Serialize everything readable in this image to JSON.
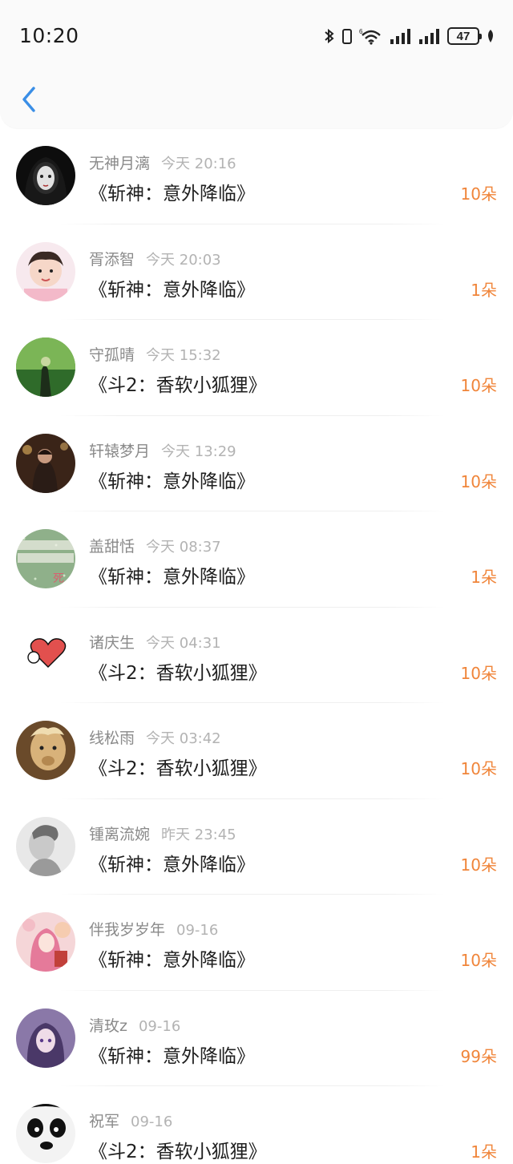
{
  "status_bar": {
    "time": "10:20",
    "battery": "47",
    "icons": [
      "bluetooth-icon",
      "vibrate-icon",
      "wifi-6-icon",
      "signal-icon",
      "signal-icon",
      "battery-icon",
      "leaf-icon"
    ]
  },
  "header": {
    "back_icon": "chevron-left-icon",
    "accent_color": "#3a8ee6"
  },
  "colors": {
    "count": "#f0853a",
    "name": "#8a8a8a",
    "time": "#b3b3b3",
    "title": "#1f1f1f"
  },
  "items": [
    {
      "name": "无神月漓",
      "time": "今天 20:16",
      "title": "《斩神：意外降临》",
      "count": "10朵",
      "avatar": "dark-gothic-girl"
    },
    {
      "name": "胥添智",
      "time": "今天 20:03",
      "title": "《斩神：意外降临》",
      "count": "1朵",
      "avatar": "baby-girl"
    },
    {
      "name": "守孤晴",
      "time": "今天 15:32",
      "title": "《斗2：香软小狐狸》",
      "count": "10朵",
      "avatar": "green-field"
    },
    {
      "name": "轩辕梦月",
      "time": "今天 13:29",
      "title": "《斩神：意外降临》",
      "count": "10朵",
      "avatar": "night-couple"
    },
    {
      "name": "盖甜恬",
      "time": "今天 08:37",
      "title": "《斩神：意外降临》",
      "count": "1朵",
      "avatar": "green-text"
    },
    {
      "name": "诸庆生",
      "time": "今天 04:31",
      "title": "《斗2：香软小狐狸》",
      "count": "10朵",
      "avatar": "heart-sticker"
    },
    {
      "name": "线松雨",
      "time": "今天 03:42",
      "title": "《斗2：香软小狐狸》",
      "count": "10朵",
      "avatar": "alpaca"
    },
    {
      "name": "锺离流婉",
      "time": "昨天 23:45",
      "title": "《斩神：意外降临》",
      "count": "10朵",
      "avatar": "grey-woman"
    },
    {
      "name": "伴我岁岁年",
      "time": "09-16",
      "title": "《斩神：意外降临》",
      "count": "10朵",
      "avatar": "pink-anime"
    },
    {
      "name": "清玫z",
      "time": "09-16",
      "title": "《斩神：意外降临》",
      "count": "99朵",
      "avatar": "purple-anime"
    },
    {
      "name": "祝军",
      "time": "09-16",
      "title": "《斗2：香软小狐狸》",
      "count": "1朵",
      "avatar": "panda"
    }
  ]
}
